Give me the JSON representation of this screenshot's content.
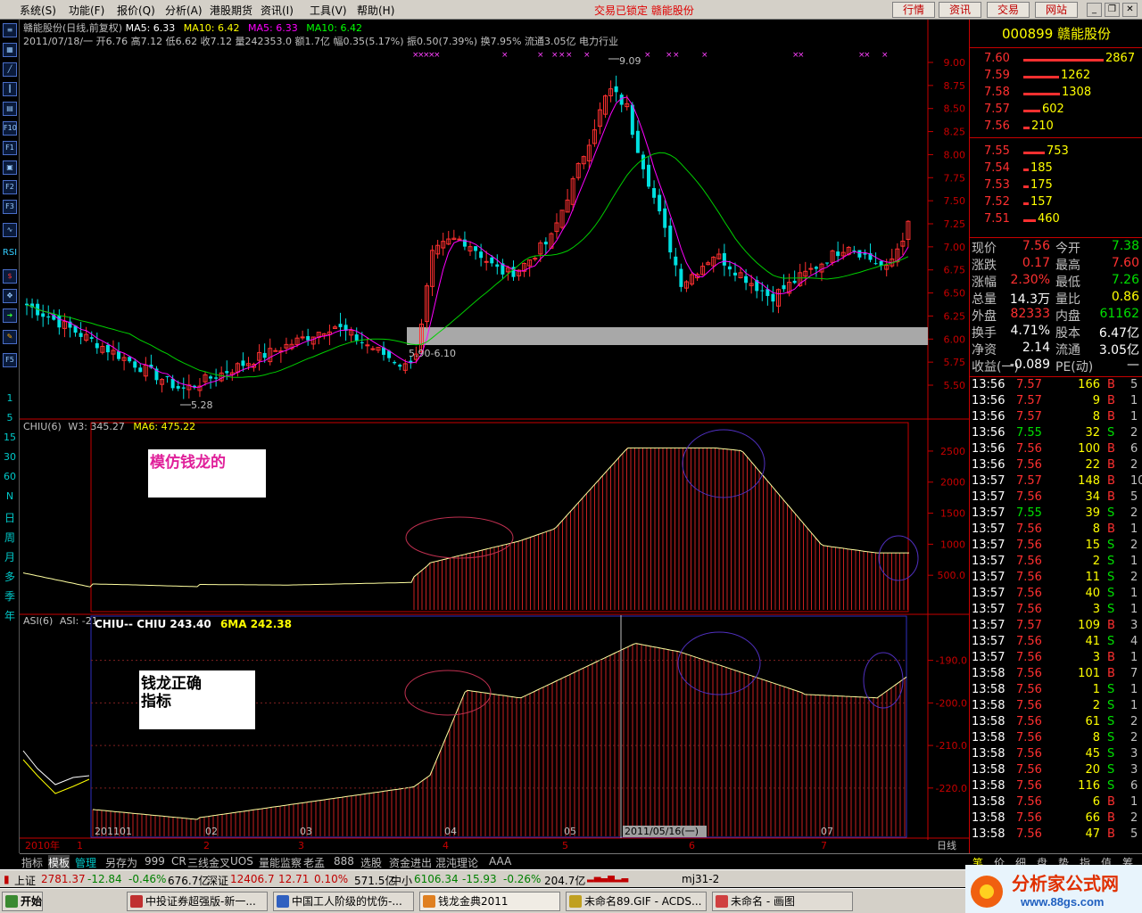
{
  "menubar": {
    "items": [
      "系统(S)",
      "功能(F)",
      "报价(Q)",
      "分析(A)",
      "港股期货",
      "资讯(I)",
      "工具(V)",
      "帮助(H)"
    ],
    "lock_info": "交易已锁定  赣能股份",
    "buttons": [
      "行情",
      "资讯",
      "交易",
      "网站"
    ]
  },
  "left_toolbar": {
    "icon_labels": [
      "F10",
      "F1",
      "F2",
      "F3",
      "RSI"
    ],
    "periods": [
      "1",
      "5",
      "15",
      "30",
      "60",
      "N",
      "日",
      "周",
      "月",
      "多",
      "季",
      "年"
    ]
  },
  "main_chart": {
    "title_line": "赣能股份(日线,前复权) ",
    "ma_labels": [
      "MA5: 6.33",
      "MA10: 6.42",
      "MA5: 6.33",
      "MA10: 6.42"
    ],
    "ma_colors": [
      "#ffffff",
      "#ffff00",
      "#ff00ff",
      "#00ff00"
    ],
    "info_line": "2011/07/18/一 开6.76 高7.12 低6.62 收7.12 量242353.0 额1.7亿 幅0.35(5.17%) 振0.50(7.39%) 换7.95% 流通3.05亿 电力行业",
    "price_ticks": [
      "9.00",
      "8.75",
      "8.50",
      "8.25",
      "8.00",
      "7.75",
      "7.50",
      "7.25",
      "7.00",
      "6.75",
      "6.50",
      "6.25",
      "6.00",
      "5.75",
      "5.50"
    ],
    "annotations": [
      "9.09",
      "5.28",
      "5.90-6.10"
    ],
    "marker": "×"
  },
  "indicator1": {
    "label": "CHIU(6)",
    "w3": "W3: 345.27",
    "ma6": "MA6: 475.22",
    "ticks": [
      "2500",
      "2000",
      "1500",
      "1000",
      "500.0"
    ],
    "note": "模仿钱龙的"
  },
  "indicator2": {
    "label": "ASI(6)",
    "asi": "ASI: -21",
    "chiu": "CHIU-- CHIU 243.40",
    "ma": "6MA 242.38",
    "ticks": [
      "-190.0",
      "-200.0",
      "-210.0",
      "-220.0"
    ],
    "note": "钱龙正确指标"
  },
  "x_axis": {
    "labels": [
      "201101",
      "02",
      "03",
      "04",
      "05",
      "2011/05/16(一)",
      "07"
    ],
    "month_marks": [
      "2010年",
      "1",
      "2",
      "3",
      "4",
      "5",
      "6",
      "7"
    ],
    "period": "日线"
  },
  "chart_data": {
    "type": "candlestick",
    "title": "赣能股份(日线,前复权)",
    "ylim": [
      5.4,
      9.15
    ],
    "high_point": 9.09,
    "low_point": 5.28,
    "range_band": [
      5.9,
      6.1
    ],
    "last_close": 7.12,
    "segments": [
      {
        "period": "2010-12",
        "close_range": [
          5.7,
          6.4
        ]
      },
      {
        "period": "2011-01",
        "close_range": [
          5.4,
          6.0
        ]
      },
      {
        "period": "2011-02",
        "close_range": [
          5.6,
          6.1
        ]
      },
      {
        "period": "2011-03",
        "close_range": [
          5.6,
          6.2
        ]
      },
      {
        "period": "2011-04",
        "close_range": [
          6.5,
          7.8
        ]
      },
      {
        "period": "2011-05",
        "close_range": [
          7.2,
          9.09
        ]
      },
      {
        "period": "2011-06",
        "close_range": [
          6.2,
          7.2
        ]
      },
      {
        "period": "2011-07",
        "close_range": [
          6.6,
          7.6
        ]
      }
    ],
    "chiu_range": [
      300,
      2550
    ],
    "asi_range": [
      -226,
      -186
    ]
  },
  "right_panel": {
    "code_name": "000899 赣能股份",
    "sell_orders": [
      {
        "price": "7.60",
        "vol": "2867"
      },
      {
        "price": "7.59",
        "vol": "1262"
      },
      {
        "price": "7.58",
        "vol": "1308"
      },
      {
        "price": "7.57",
        "vol": "602"
      },
      {
        "price": "7.56",
        "vol": "210"
      }
    ],
    "buy_orders": [
      {
        "price": "7.55",
        "vol": "753"
      },
      {
        "price": "7.54",
        "vol": "185"
      },
      {
        "price": "7.53",
        "vol": "175"
      },
      {
        "price": "7.52",
        "vol": "157"
      },
      {
        "price": "7.51",
        "vol": "460"
      }
    ],
    "stats": [
      [
        "现价",
        "7.56",
        "今开",
        "7.38"
      ],
      [
        "涨跌",
        "0.17",
        "最高",
        "7.60"
      ],
      [
        "涨幅",
        "2.30%",
        "最低",
        "7.26"
      ],
      [
        "总量",
        "14.3万",
        "量比",
        "0.86"
      ],
      [
        "外盘",
        "82333",
        "内盘",
        "61162"
      ],
      [
        "换手",
        "4.71%",
        "股本",
        "6.47亿"
      ],
      [
        "净资",
        "2.14",
        "流通",
        "3.05亿"
      ],
      [
        "收益(一)",
        "-0.089",
        "PE(动)",
        "—"
      ]
    ],
    "ticks": [
      [
        "13:56",
        "7.57",
        "166",
        "B",
        "5"
      ],
      [
        "13:56",
        "7.57",
        "9",
        "B",
        "1"
      ],
      [
        "13:56",
        "7.57",
        "8",
        "B",
        "1"
      ],
      [
        "13:56",
        "7.55",
        "32",
        "S",
        "2"
      ],
      [
        "13:56",
        "7.56",
        "100",
        "B",
        "6"
      ],
      [
        "13:56",
        "7.56",
        "22",
        "B",
        "2"
      ],
      [
        "13:57",
        "7.57",
        "148",
        "B",
        "10"
      ],
      [
        "13:57",
        "7.56",
        "34",
        "B",
        "5"
      ],
      [
        "13:57",
        "7.55",
        "39",
        "S",
        "2"
      ],
      [
        "13:57",
        "7.56",
        "8",
        "B",
        "1"
      ],
      [
        "13:57",
        "7.56",
        "15",
        "S",
        "2"
      ],
      [
        "13:57",
        "7.56",
        "2",
        "S",
        "1"
      ],
      [
        "13:57",
        "7.56",
        "11",
        "S",
        "2"
      ],
      [
        "13:57",
        "7.56",
        "40",
        "S",
        "1"
      ],
      [
        "13:57",
        "7.56",
        "3",
        "S",
        "1"
      ],
      [
        "13:57",
        "7.57",
        "109",
        "B",
        "3"
      ],
      [
        "13:57",
        "7.56",
        "41",
        "S",
        "4"
      ],
      [
        "13:57",
        "7.56",
        "3",
        "B",
        "1"
      ],
      [
        "13:58",
        "7.56",
        "101",
        "B",
        "7"
      ],
      [
        "13:58",
        "7.56",
        "1",
        "S",
        "1"
      ],
      [
        "13:58",
        "7.56",
        "2",
        "S",
        "1"
      ],
      [
        "13:58",
        "7.56",
        "61",
        "S",
        "2"
      ],
      [
        "13:58",
        "7.56",
        "8",
        "S",
        "2"
      ],
      [
        "13:58",
        "7.56",
        "45",
        "S",
        "3"
      ],
      [
        "13:58",
        "7.56",
        "20",
        "S",
        "3"
      ],
      [
        "13:58",
        "7.56",
        "116",
        "S",
        "6"
      ],
      [
        "13:58",
        "7.56",
        "6",
        "B",
        "1"
      ],
      [
        "13:58",
        "7.56",
        "66",
        "B",
        "2"
      ],
      [
        "13:58",
        "7.56",
        "47",
        "B",
        "5"
      ]
    ]
  },
  "bottom_tabs": [
    "指标",
    "模板",
    "管理",
    "另存为",
    "999",
    "CR",
    "三线金叉",
    "UOS",
    "量能监察",
    "老孟",
    "888",
    "选股",
    "资金进出",
    "混沌理论",
    "AAA"
  ],
  "right_tabs": [
    "笔",
    "价",
    "细",
    "盘",
    "势",
    "指",
    "值",
    "筹"
  ],
  "statusbar": {
    "sh_label": "上证",
    "sh_value": "2781.37",
    "sh_change": "-12.84",
    "sh_pct": "-0.46%",
    "sh_amount": "676.7亿",
    "sz_label": "深证",
    "sz_value": "12406.7",
    "sz_change": "12.71",
    "sz_pct": "0.10%",
    "sz_amount": "571.5亿",
    "zx_label": "中小",
    "zx_value": "6106.34",
    "zx_change": "-15.93",
    "zx_pct": "-0.26%",
    "zx_amount": "204.7亿",
    "user": "mj31-2"
  },
  "taskbar": {
    "start": "开始",
    "tasks": [
      "中投证券超强版-新一...",
      "中国工人阶级的忧伤-...",
      "钱龙金典2011",
      "未命名89.GIF - ACDS...",
      "未命名 - 画图"
    ]
  },
  "logo": {
    "name": "分析家公式网",
    "url": "www.88gs.com"
  }
}
